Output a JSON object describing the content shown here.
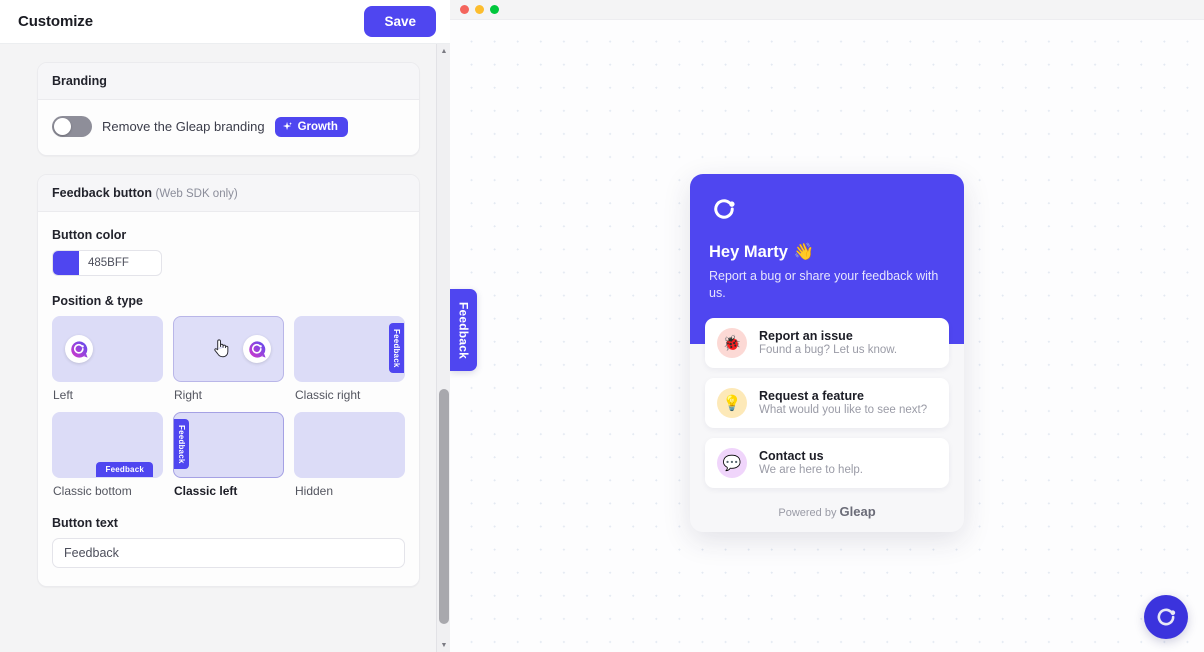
{
  "left_panel": {
    "title": "Customize",
    "save_label": "Save",
    "branding": {
      "heading": "Branding",
      "toggle_label": "Remove the Gleap branding",
      "toggle_on": false,
      "badge_label": "Growth",
      "badge_icon": "sparkle-icon",
      "badge_color": "#4F46F0"
    },
    "feedback_button": {
      "heading": "Feedback button",
      "heading_note": "(Web SDK only)",
      "button_color_label": "Button color",
      "button_color_value": "485BFF",
      "button_color_hex": "#4F46F0",
      "position_label": "Position & type",
      "positions": [
        {
          "id": "left",
          "caption": "Left",
          "selected": false,
          "hover": false
        },
        {
          "id": "right",
          "caption": "Right",
          "selected": false,
          "hover": true
        },
        {
          "id": "classic-right",
          "caption": "Classic right",
          "selected": false,
          "hover": false
        },
        {
          "id": "classic-bottom",
          "caption": "Classic bottom",
          "selected": false,
          "hover": false
        },
        {
          "id": "classic-left",
          "caption": "Classic left",
          "selected": true,
          "hover": false
        },
        {
          "id": "hidden",
          "caption": "Hidden",
          "selected": false,
          "hover": false
        }
      ],
      "tile_tab_label": "Feedback",
      "button_text_label": "Button text",
      "button_text_value": "Feedback",
      "button_text_placeholder": "Feedback"
    }
  },
  "preview": {
    "window_dots": [
      "#F4645C",
      "#FCBD2E",
      "#00C73C"
    ],
    "side_tab_label": "Feedback",
    "widget": {
      "logo_icon": "gleap-logo-icon",
      "greeting": "Hey Marty",
      "greeting_emoji": "👋",
      "subtitle": "Report a bug or share your feedback with us.",
      "header_color": "#4F46F0",
      "items": [
        {
          "icon": "bug-icon",
          "emoji": "🐞",
          "title": "Report an issue",
          "desc": "Found a bug? Let us know."
        },
        {
          "icon": "bulb-icon",
          "emoji": "💡",
          "title": "Request a feature",
          "desc": "What would you like to see next?"
        },
        {
          "icon": "chat-icon",
          "emoji": "💬",
          "title": "Contact us",
          "desc": "We are here to help."
        }
      ],
      "footer_prefix": "Powered by",
      "footer_brand": "Gleap"
    },
    "fab_icon": "gleap-logo-icon"
  }
}
